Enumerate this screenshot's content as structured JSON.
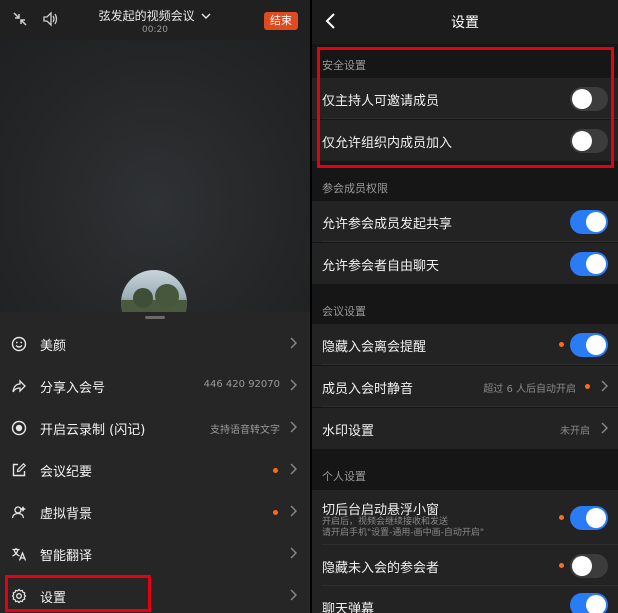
{
  "left": {
    "meeting_title": "弦发起的视频会议",
    "meeting_time": "00:20",
    "end_button": "结束",
    "menu": [
      {
        "label": "美颜",
        "right": "",
        "dot": false,
        "icon": "smile-icon"
      },
      {
        "label": "分享入会号",
        "right": "446 420 92070",
        "dot": false,
        "icon": "share-icon"
      },
      {
        "label": "开启云录制 (闪记)",
        "right": "支持语音转文字",
        "dot": false,
        "icon": "record-icon"
      },
      {
        "label": "会议纪要",
        "right": "",
        "dot": true,
        "icon": "edit-notes-icon"
      },
      {
        "label": "虚拟背景",
        "right": "",
        "dot": true,
        "icon": "virtual-background-icon"
      },
      {
        "label": "智能翻译",
        "right": "",
        "dot": false,
        "icon": "translate-icon"
      },
      {
        "label": "设置",
        "right": "",
        "dot": false,
        "icon": "gear-icon"
      }
    ]
  },
  "right": {
    "title": "设置",
    "sections": {
      "security": {
        "title": "安全设置",
        "rows": [
          {
            "label": "仅主持人可邀请成员",
            "toggle": "off"
          },
          {
            "label": "仅允许组织内成员加入",
            "toggle": "off"
          }
        ]
      },
      "participants": {
        "title": "参会成员权限",
        "rows": [
          {
            "label": "允许参会成员发起共享",
            "toggle": "on"
          },
          {
            "label": "允许参会者自由聊天",
            "toggle": "on"
          }
        ]
      },
      "meeting": {
        "title": "会议设置",
        "rows": [
          {
            "label": "隐藏入会离会提醒",
            "toggle": "on",
            "dot": true
          },
          {
            "label": "成员入会时静音",
            "value": "超过 6 人后自动开启",
            "dot": true
          },
          {
            "label": "水印设置",
            "value": "未开启"
          }
        ]
      },
      "personal": {
        "title": "个人设置",
        "rows": [
          {
            "label": "切后台启动悬浮小窗",
            "sub1": "开启后，视频会继续接收和发送",
            "sub2": "请开启手机\"设置-通用-画中画-自动开启\"",
            "toggle": "on",
            "dot": true
          },
          {
            "label": "隐藏未入会的参会者",
            "toggle": "off",
            "dot": true
          },
          {
            "label": "聊天弹幕",
            "toggle": "on"
          }
        ]
      }
    }
  },
  "colors": {
    "accent": "#2a7cf6",
    "highlight": "#e60012",
    "dot": "#ff6a1a",
    "end_button": "#e04a1f"
  }
}
